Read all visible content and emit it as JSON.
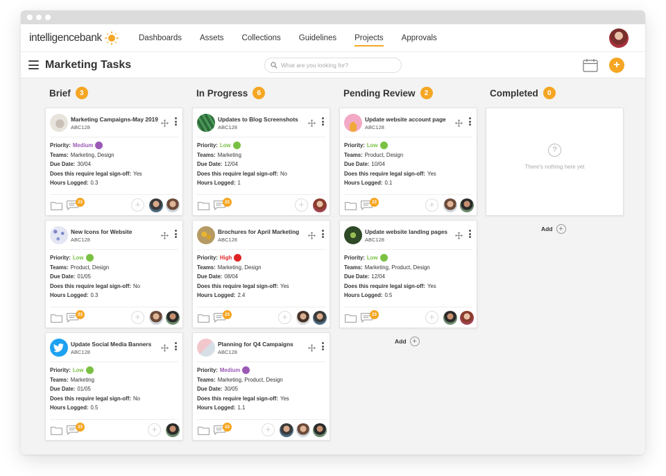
{
  "app": {
    "brand_name": "intelligencebank",
    "nav": [
      "Dashboards",
      "Assets",
      "Collections",
      "Guidelines",
      "Projects",
      "Approvals"
    ],
    "active_nav": "Projects"
  },
  "toolbar": {
    "title": "Marketing Tasks",
    "search_placeholder": "What are you looking for?"
  },
  "labels": {
    "priority": "Priority:",
    "teams": "Teams:",
    "due": "Due Date:",
    "legal": "Does this require legal sign-off:",
    "hours": "Hours Logged:",
    "add": "Add",
    "empty": "There's nothing here yet"
  },
  "colors": {
    "accent": "#f5a623",
    "medium": "#9b59b6",
    "low": "#7ac143",
    "high": "#e02424"
  },
  "columns": [
    {
      "title": "Brief",
      "count": "3",
      "cards": [
        {
          "title": "Marketing Campaigns-May 2019",
          "code": "ABC128",
          "thumb": "campaign-thumbnail",
          "priority": "Medium",
          "teams": "Marketing, Design",
          "due": "30/04",
          "legal": "Yes",
          "hours": "0.3",
          "comments": "23",
          "assignees": [
            "assignee-avatar",
            "assignee-avatar"
          ]
        },
        {
          "title": "New Icons for Website",
          "code": "ABC128",
          "thumb": "icons-thumbnail",
          "priority": "Low",
          "teams": "Product, Design",
          "due": "01/05",
          "legal": "No",
          "hours": "0.3",
          "comments": "23",
          "assignees": [
            "assignee-avatar",
            "assignee-avatar"
          ]
        },
        {
          "title": "Update Social Media Banners",
          "code": "ABC128",
          "thumb": "twitter-icon",
          "priority": "Low",
          "teams": "Marketing",
          "due": "01/05",
          "legal": "No",
          "hours": "0.5",
          "comments": "23",
          "assignees": [
            "assignee-avatar"
          ]
        }
      ]
    },
    {
      "title": "In Progress",
      "count": "6",
      "cards": [
        {
          "title": "Updates to Blog Screenshots",
          "code": "ABC128",
          "thumb": "blog-thumbnail",
          "priority": "Low",
          "teams": "Marketing",
          "due": "12/04",
          "legal": "No",
          "hours": "1",
          "comments": "23",
          "assignees": [
            "assignee-avatar"
          ]
        },
        {
          "title": "Brochures for April Marketing",
          "code": "ABC128",
          "thumb": "brochure-thumbnail",
          "priority": "High",
          "teams": "Marketing, Design",
          "due": "08/04",
          "legal": "Yes",
          "hours": "2.4",
          "comments": "23",
          "assignees": [
            "assignee-avatar",
            "assignee-avatar"
          ]
        },
        {
          "title": "Planning for Q4 Campaigns",
          "code": "ABC128",
          "thumb": "planning-thumbnail",
          "priority": "Medium",
          "teams": "Marketing, Product, Design",
          "due": "30/05",
          "legal": "Yes",
          "hours": "1.1",
          "comments": "23",
          "assignees": [
            "assignee-avatar",
            "assignee-avatar",
            "assignee-avatar"
          ]
        }
      ]
    },
    {
      "title": "Pending Review",
      "count": "2",
      "cards": [
        {
          "title": "Update website account page",
          "code": "ABC128",
          "thumb": "account-thumbnail",
          "priority": "Low",
          "teams": "Product, Design",
          "due": "10/04",
          "legal": "Yes",
          "hours": "0.1",
          "comments": "23",
          "assignees": [
            "assignee-avatar",
            "assignee-avatar"
          ]
        },
        {
          "title": "Update website landing pages",
          "code": "ABC128",
          "thumb": "landing-thumbnail",
          "priority": "Low",
          "teams": "Marketing, Product, Design",
          "due": "12/04",
          "legal": "Yes",
          "hours": "0.5",
          "comments": "23",
          "assignees": [
            "assignee-avatar",
            "assignee-avatar"
          ]
        }
      ]
    },
    {
      "title": "Completed",
      "count": "0",
      "cards": []
    }
  ]
}
